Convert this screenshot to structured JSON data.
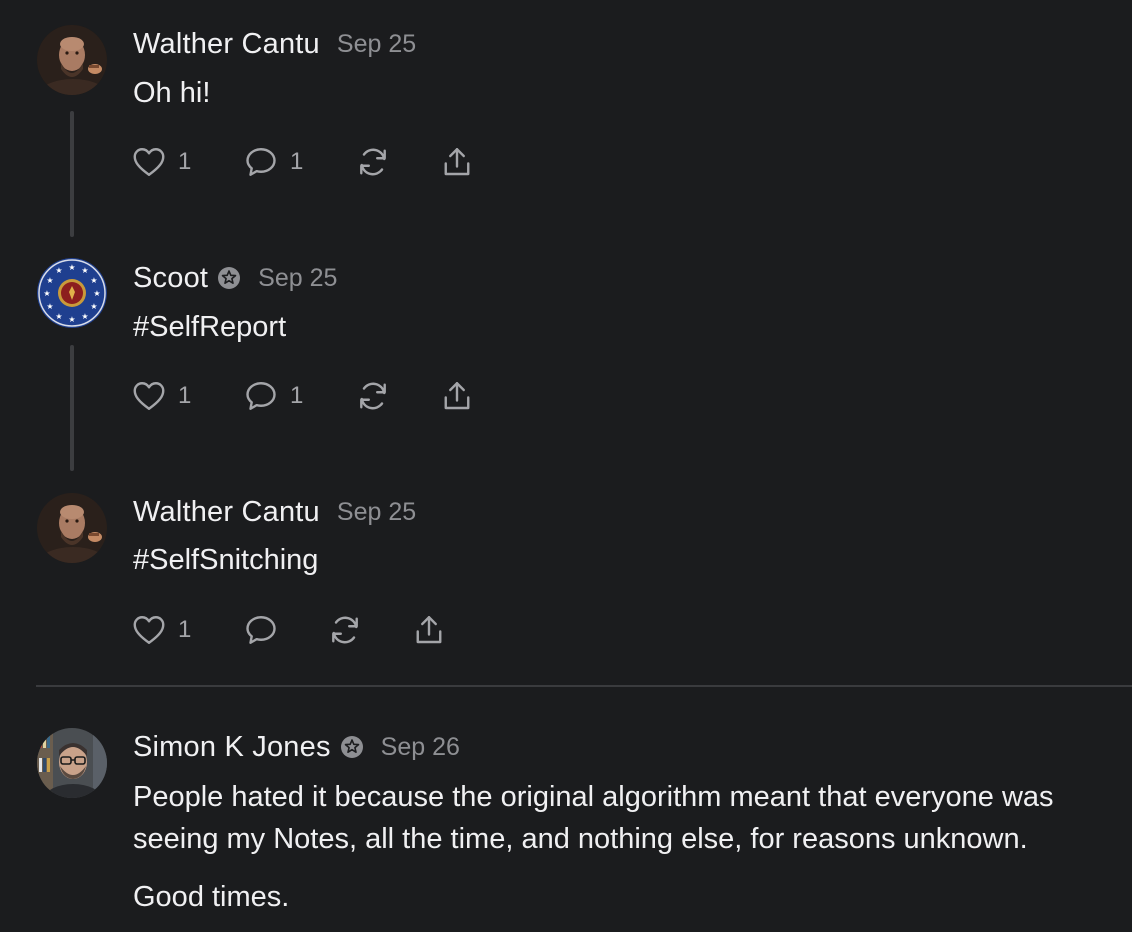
{
  "notes": [
    {
      "author": "Walther Cantu",
      "date": "Sep 25",
      "text": "Oh hi!",
      "likes": "1",
      "comments": "1",
      "avatar": "bearded-man-avatar"
    },
    {
      "author": "Scoot",
      "date": "Sep 25",
      "text": "#SelfReport",
      "likes": "1",
      "comments": "1",
      "verified": true,
      "avatar": "blue-star-emblem-avatar"
    },
    {
      "author": "Walther Cantu",
      "date": "Sep 25",
      "text": "#SelfSnitching",
      "likes": "1",
      "comments": "",
      "avatar": "bearded-man-avatar"
    },
    {
      "author": "Simon K Jones",
      "date": "Sep 26",
      "text_lines": [
        "People hated it because the original algorithm meant that everyone was",
        "seeing my Notes, all the time, and nothing else, for reasons unknown."
      ],
      "text_extra": "Good times.",
      "verified": true,
      "avatar": "man-with-glasses-avatar"
    }
  ],
  "colors": {
    "background": "#1b1c1e",
    "text": "#f0f0f2",
    "muted": "#8e8f93",
    "thread_line": "#3c3d40"
  },
  "icons": [
    "heart-icon",
    "comment-icon",
    "restack-icon",
    "share-icon",
    "verified-badge-icon"
  ]
}
